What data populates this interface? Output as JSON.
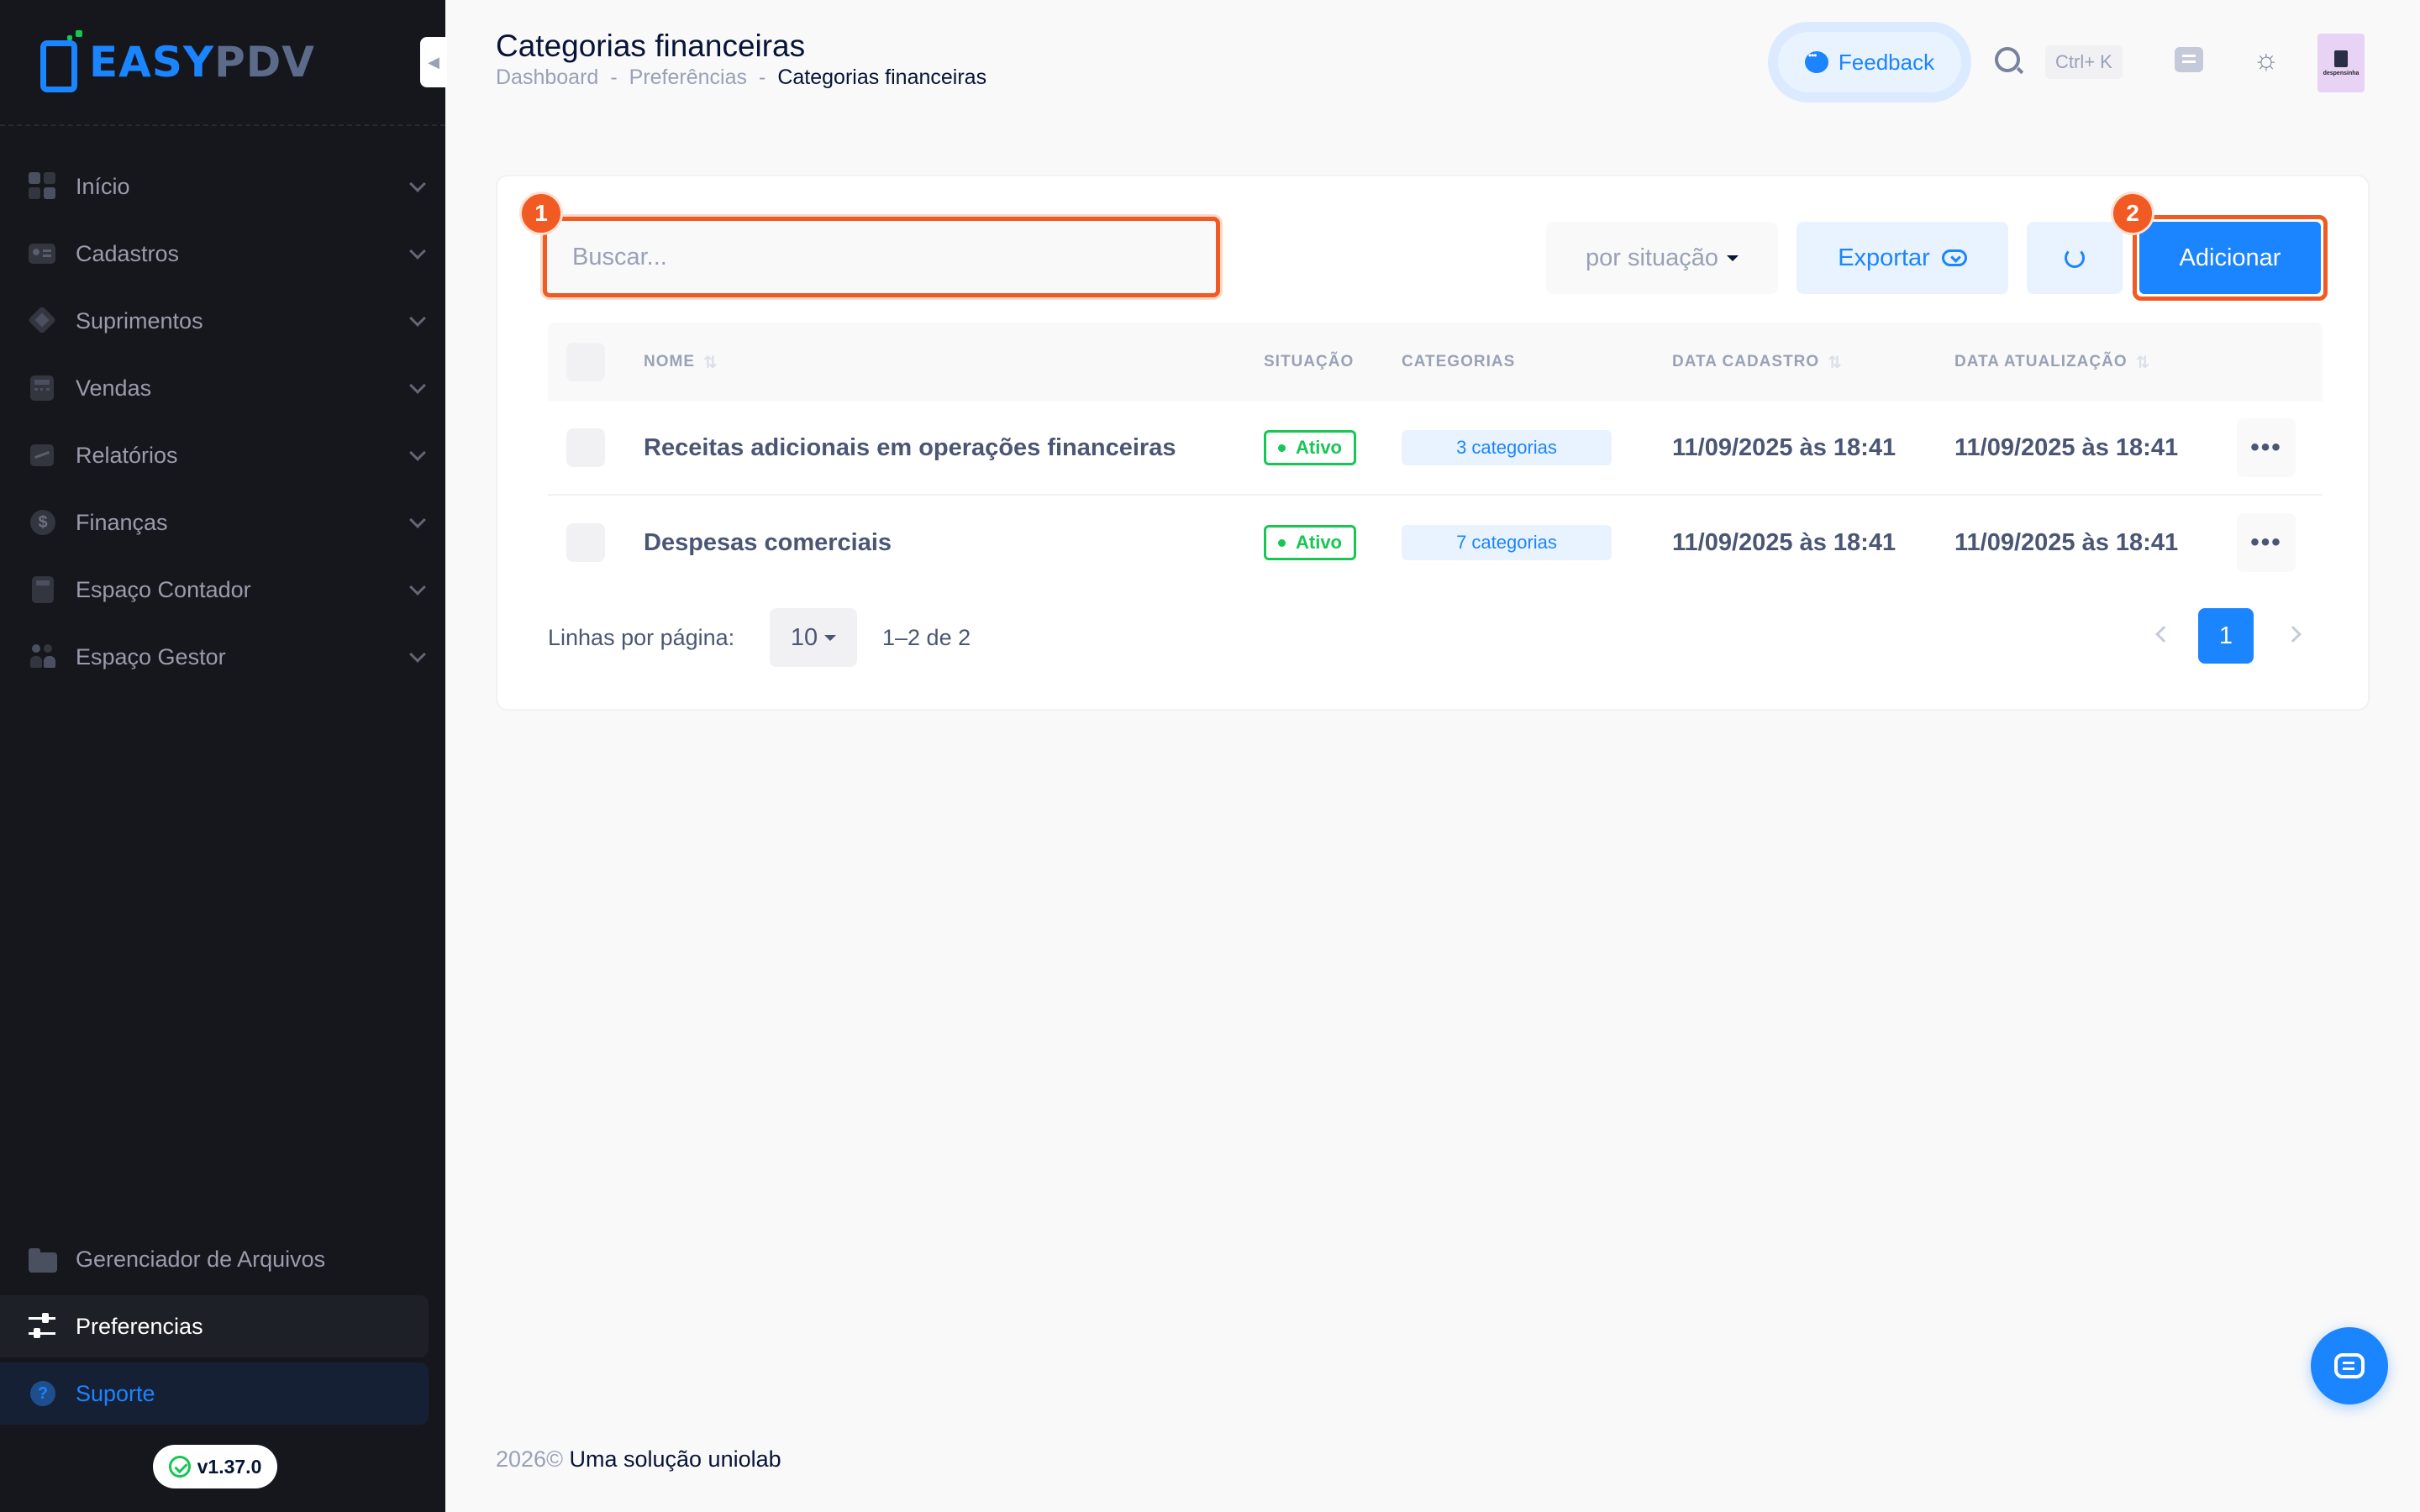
{
  "app": {
    "logo_part1": "EASY",
    "logo_part2": "PDV",
    "version": "v1.37.0"
  },
  "sidebar": {
    "items": [
      {
        "label": "Início",
        "icon": "grid-icon"
      },
      {
        "label": "Cadastros",
        "icon": "id-card-icon"
      },
      {
        "label": "Suprimentos",
        "icon": "box-icon"
      },
      {
        "label": "Vendas",
        "icon": "calculator-icon"
      },
      {
        "label": "Relatórios",
        "icon": "chart-icon"
      },
      {
        "label": "Finanças",
        "icon": "dollar-icon"
      },
      {
        "label": "Espaço Contador",
        "icon": "calculator-icon"
      },
      {
        "label": "Espaço Gestor",
        "icon": "people-icon"
      }
    ],
    "bottom": {
      "files": "Gerenciador de Arquivos",
      "prefs": "Preferencias",
      "support": "Suporte"
    }
  },
  "header": {
    "title": "Categorias financeiras",
    "breadcrumb": [
      "Dashboard",
      "-",
      "Preferências",
      "-",
      "Categorias financeiras"
    ],
    "feedback": "Feedback",
    "shortcut": "Ctrl+ K",
    "avatar_text": "despensinha"
  },
  "toolbar": {
    "search_placeholder": "Buscar...",
    "filter": "por situação",
    "export": "Exportar",
    "add": "Adicionar",
    "callout_1": "1",
    "callout_2": "2"
  },
  "table": {
    "headers": {
      "name": "NOME",
      "status": "SITUAÇÃO",
      "categories": "CATEGORIAS",
      "created": "DATA CADASTRO",
      "updated": "DATA ATUALIZAÇÃO"
    },
    "rows": [
      {
        "name": "Receitas adicionais em operações financeiras",
        "status": "Ativo",
        "categories": "3 categorias",
        "created": "11/09/2025 às 18:41",
        "updated": "11/09/2025 às 18:41"
      },
      {
        "name": "Despesas comerciais",
        "status": "Ativo",
        "categories": "7 categorias",
        "created": "11/09/2025 às 18:41",
        "updated": "11/09/2025 às 18:41"
      }
    ]
  },
  "pagination": {
    "rows_label": "Linhas por página:",
    "rows_value": "10",
    "range": "1–2 de 2",
    "current": "1"
  },
  "footer": {
    "year": "2026©",
    "text": "Uma solução uniolab"
  },
  "colors": {
    "primary": "#1b84ff",
    "success": "#17c653",
    "highlight": "#f15a22",
    "sidebar_bg": "#15171c"
  }
}
